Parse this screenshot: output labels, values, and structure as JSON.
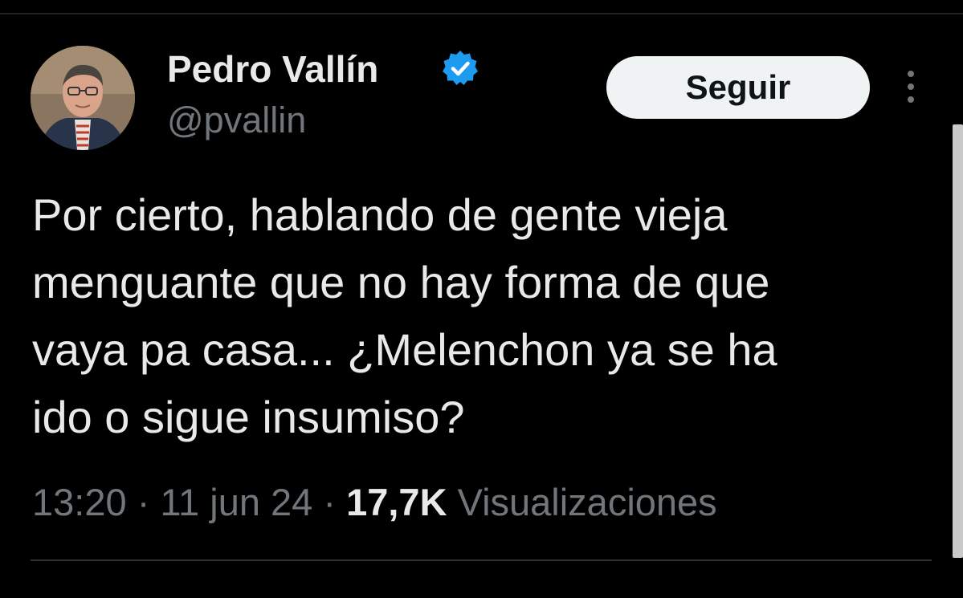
{
  "user": {
    "display_name": "Pedro Vallín",
    "handle": "@pvallin"
  },
  "actions": {
    "follow_label": "Seguir"
  },
  "tweet": {
    "lines": [
      "Por cierto, hablando de gente vieja",
      "menguante que no hay forma de que",
      "vaya pa casa... ¿Melenchon ya se ha",
      "ido o sigue insumiso?"
    ],
    "time": "13:20",
    "separator": "·",
    "date": "11 jun 24",
    "views_count": "17,7K",
    "views_label": "Visualizaciones"
  },
  "icons": {
    "verified": "verified-badge-icon",
    "more": "more-vertical-icon"
  },
  "colors": {
    "background": "#000000",
    "primary_text": "#e7e9ea",
    "secondary_text": "#71767b",
    "verified": "#1d9bf0",
    "follow_bg": "#eff3f4"
  }
}
